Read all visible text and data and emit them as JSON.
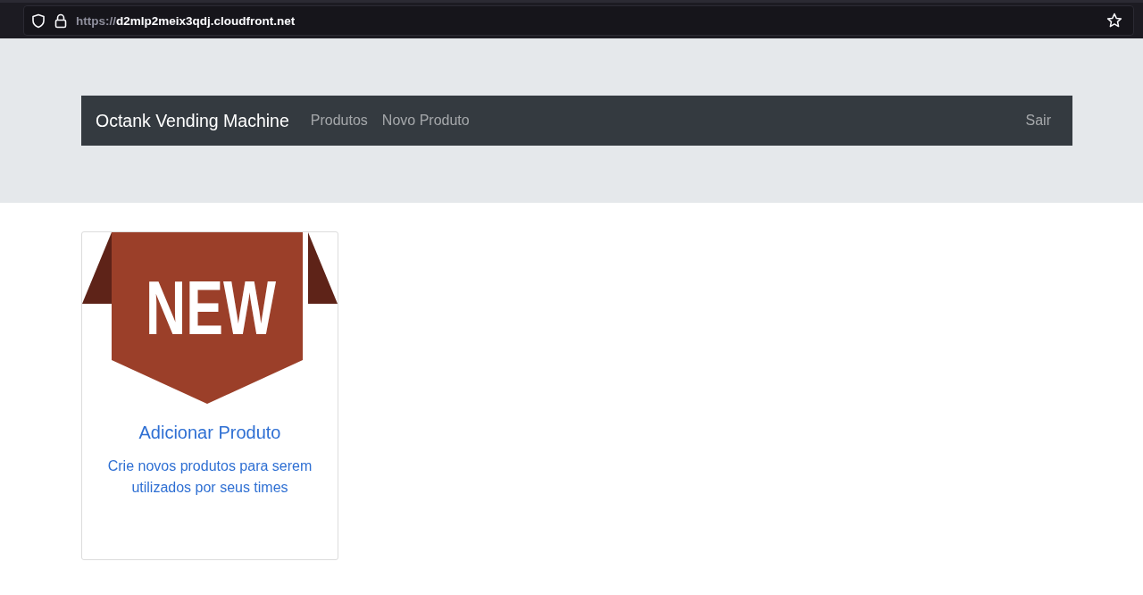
{
  "browser": {
    "url": {
      "scheme": "https://",
      "host": "d2mlp2meix3qdj.cloudfront.net"
    }
  },
  "navbar": {
    "brand": "Octank Vending Machine",
    "links": [
      "Produtos",
      "Novo Produto"
    ],
    "logout": "Sair"
  },
  "cards": [
    {
      "badge": "NEW",
      "title": "Adicionar Produto",
      "text": "Crie novos produtos para serem utilizados por seus times"
    }
  ]
}
